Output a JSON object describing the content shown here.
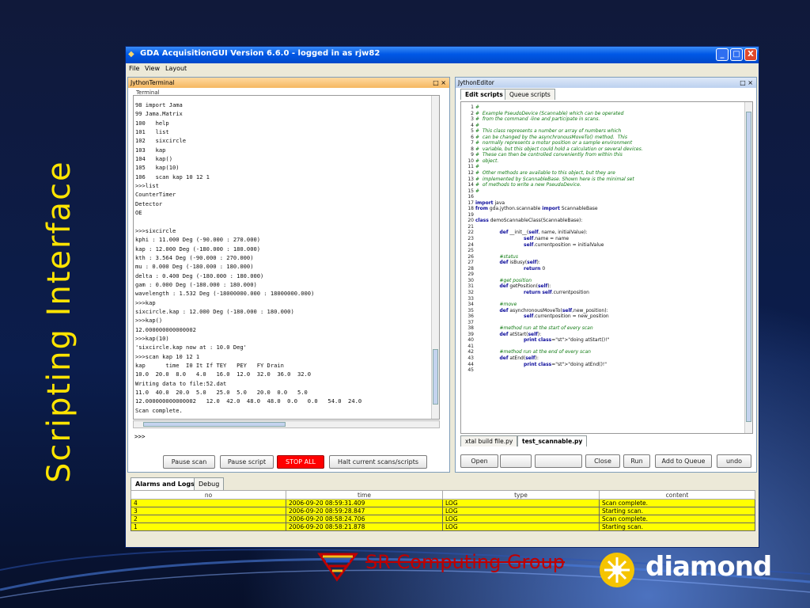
{
  "slide": {
    "title": "Scripting Interface"
  },
  "window": {
    "title": "GDA AcquisitionGUI Version 6.6.0 - logged in as rjw82",
    "minimize": "_",
    "maximize": "□",
    "close": "X"
  },
  "menu": {
    "items": [
      "File",
      "View",
      "Layout"
    ]
  },
  "terminal_panel": {
    "title": "JythonTerminal",
    "subtitle": "Terminal",
    "lines": [
      "98 import Jama",
      "99 Jama.Matrix",
      "100   help",
      "101   list",
      "102   sixcircle",
      "103   kap",
      "104   kap()",
      "105   kap(10)",
      "106   scan kap 10 12 1",
      ">>>list",
      "CounterTimer",
      "Detector",
      "OE",
      "",
      ">>>sixcircle",
      "kphi : 11.000 Deg (-90.000 : 270.000)",
      "kap : 12.000 Deg (-180.000 : 180.000)",
      "kth : 3.564 Deg (-90.000 : 270.000)",
      "mu : 0.000 Deg (-180.000 : 180.000)",
      "delta : 0.400 Deg (-180.000 : 180.000)",
      "gam : 0.000 Deg (-180.000 : 180.000)",
      "wavelength : 1.532 Deg (-18000000.000 : 18000000.000)",
      ">>>kap",
      "sixcircle.kap : 12.000 Deg (-180.000 : 180.000)",
      ">>>kap()",
      "12.000000000000002",
      ">>>kap(10)",
      "'sixcircle.kap now at : 10.0 Deg'",
      ">>>scan kap 10 12 1",
      "kap      time  I0 It If TEY   PEY   FY Drain",
      "10.0  20.0  8.0   4.0   16.0  12.0  32.0  36.0  32.0",
      "Writing data to file:52.dat",
      "11.0  40.0  20.0  5.0   25.0  5.0   20.0  0.0   5.0",
      "12.000000000000002   12.0  42.0  48.0  48.0  0.0   0.0   54.0  24.0",
      "Scan complete."
    ],
    "prompt": ">>>",
    "buttons": {
      "pause_scan": "Pause scan",
      "pause_script": "Pause script",
      "stop_all": "STOP ALL",
      "halt": "Halt current scans/scripts"
    }
  },
  "editor_panel": {
    "title": "JythonEditor",
    "tabs": [
      "Edit scripts",
      "Queue scripts"
    ],
    "file_tabs": [
      "xtal build file.py",
      "test_scannable.py"
    ],
    "code": [
      {
        "n": "1",
        "t": "#",
        "c": "cm"
      },
      {
        "n": "2",
        "t": "#  Example PseudoDevice (Scannable) which can be operated",
        "c": "cm"
      },
      {
        "n": "3",
        "t": "#  from the command -line and participate in scans.",
        "c": "cm"
      },
      {
        "n": "4",
        "t": "#",
        "c": "cm"
      },
      {
        "n": "5",
        "t": "#  This class represents a number or array of numbers which",
        "c": "cm"
      },
      {
        "n": "6",
        "t": "#  can be changed by the asynchronousMoveTo() method.  This",
        "c": "cm"
      },
      {
        "n": "7",
        "t": "#  normally represents a motor position or a sample environment",
        "c": "cm"
      },
      {
        "n": "8",
        "t": "#  variable, but this object could hold a calculation or several devices.",
        "c": "cm"
      },
      {
        "n": "9",
        "t": "#  These can then be controlled conveniently from within this",
        "c": "cm"
      },
      {
        "n": "10",
        "t": "#  object.",
        "c": "cm"
      },
      {
        "n": "11",
        "t": "#",
        "c": "cm"
      },
      {
        "n": "12",
        "t": "#  Other methods are available to this object, but they are",
        "c": "cm"
      },
      {
        "n": "13",
        "t": "#  implemented by ScannableBase. Shown here is the minimal set",
        "c": "cm"
      },
      {
        "n": "14",
        "t": "#  of methods to write a new PseudoDevice.",
        "c": "cm"
      },
      {
        "n": "15",
        "t": "#",
        "c": "cm"
      },
      {
        "n": "16",
        "t": "",
        "c": ""
      },
      {
        "n": "17",
        "t": "import java",
        "c": ""
      },
      {
        "n": "18",
        "t": "from gda.jython.scannable import ScannableBase",
        "c": ""
      },
      {
        "n": "19",
        "t": "",
        "c": ""
      },
      {
        "n": "20",
        "t": "class demoScannableClass(ScannableBase):",
        "c": ""
      },
      {
        "n": "21",
        "t": "",
        "c": ""
      },
      {
        "n": "22",
        "t": "                def __init__(self, name, initialValue):",
        "c": ""
      },
      {
        "n": "23",
        "t": "                                self.name = name",
        "c": ""
      },
      {
        "n": "24",
        "t": "                                self.currentposition = initialValue",
        "c": ""
      },
      {
        "n": "25",
        "t": "",
        "c": ""
      },
      {
        "n": "26",
        "t": "                #status",
        "c": "cm"
      },
      {
        "n": "27",
        "t": "                def isBusy(self):",
        "c": ""
      },
      {
        "n": "28",
        "t": "                                return 0",
        "c": ""
      },
      {
        "n": "29",
        "t": "",
        "c": ""
      },
      {
        "n": "30",
        "t": "                #get position",
        "c": "cm"
      },
      {
        "n": "31",
        "t": "                def getPosition(self):",
        "c": ""
      },
      {
        "n": "32",
        "t": "                                return self.currentposition",
        "c": ""
      },
      {
        "n": "33",
        "t": "",
        "c": ""
      },
      {
        "n": "34",
        "t": "                #move",
        "c": "cm"
      },
      {
        "n": "35",
        "t": "                def asynchronousMoveTo(self,new_position):",
        "c": ""
      },
      {
        "n": "36",
        "t": "                                self.currentposition = new_position",
        "c": ""
      },
      {
        "n": "37",
        "t": "",
        "c": ""
      },
      {
        "n": "38",
        "t": "                #method run at the start of every scan",
        "c": "cm"
      },
      {
        "n": "39",
        "t": "                def atStart(self):",
        "c": ""
      },
      {
        "n": "40",
        "t": "                                print \"doing atStart()!\"",
        "c": ""
      },
      {
        "n": "41",
        "t": "",
        "c": ""
      },
      {
        "n": "42",
        "t": "                #method run at the end of every scan",
        "c": "cm"
      },
      {
        "n": "43",
        "t": "                def atEnd(self):",
        "c": ""
      },
      {
        "n": "44",
        "t": "                                print \"doing atEnd()!\"",
        "c": ""
      },
      {
        "n": "45",
        "t": "",
        "c": ""
      }
    ],
    "buttons": {
      "open": "Open",
      "blank1": "",
      "blank2": "",
      "close": "Close",
      "run": "Run",
      "add_to_queue": "Add to Queue",
      "undo": "undo"
    }
  },
  "alarms": {
    "tabs": [
      "Alarms and Logs",
      "Debug"
    ],
    "columns": [
      "no",
      "time",
      "type",
      "content"
    ],
    "rows": [
      [
        "4",
        "2006-09-20 08:59:31.409",
        "LOG",
        "Scan complete."
      ],
      [
        "3",
        "2006-09-20 08:59:28.847",
        "LOG",
        "Starting scan."
      ],
      [
        "2",
        "2006-09-20 08:58:24.706",
        "LOG",
        "Scan complete."
      ],
      [
        "1",
        "2006-09-20 08:58:21.878",
        "LOG",
        "Starting scan."
      ]
    ]
  },
  "logos": {
    "sr_group": "SR Computing Group",
    "diamond": "diamond"
  },
  "colors": {
    "slide_title": "#ffe400",
    "stop_button": "#ff0000",
    "log_row": "#ffff00",
    "sr_logo": "#c00000"
  }
}
